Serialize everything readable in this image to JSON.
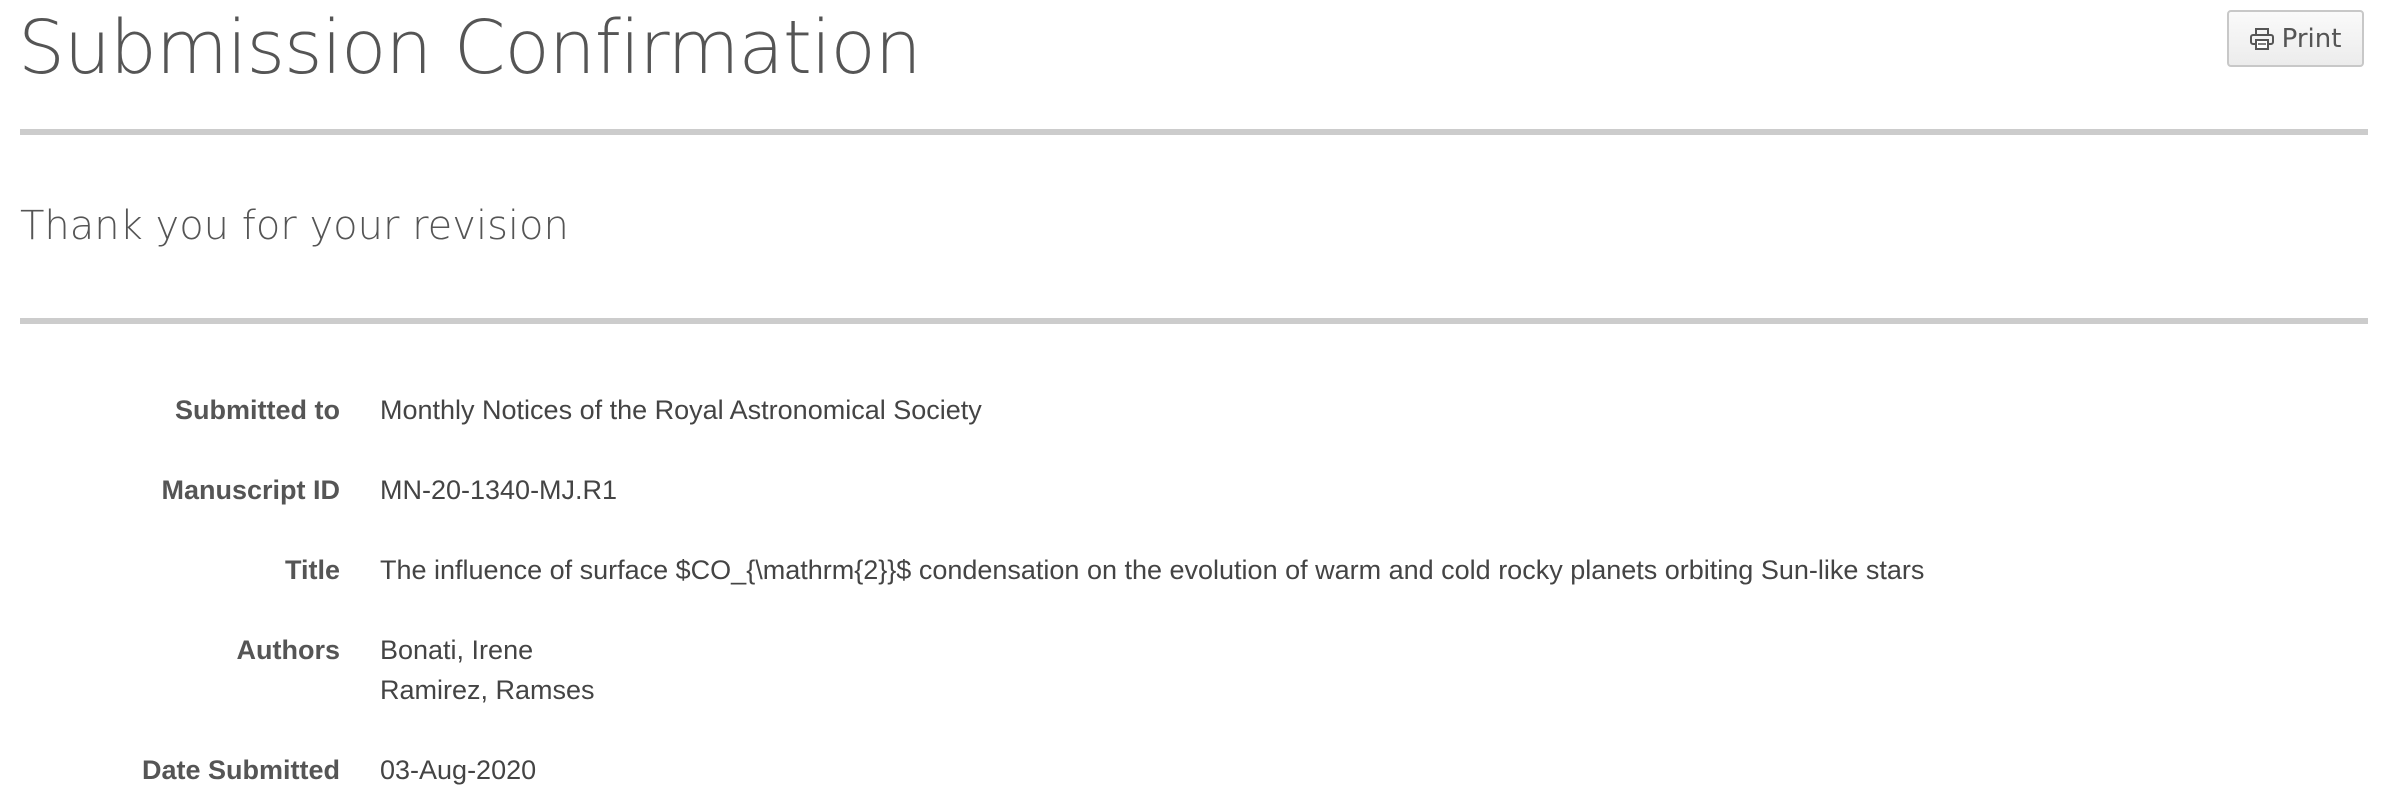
{
  "header": {
    "title": "Submission Confirmation",
    "print_label": "Print"
  },
  "message": {
    "subtitle": "Thank you for your revision"
  },
  "details": {
    "submitted_to": {
      "label": "Submitted to",
      "value": "Monthly Notices of the Royal Astronomical Society"
    },
    "manuscript_id": {
      "label": "Manuscript ID",
      "value": "MN-20-1340-MJ.R1"
    },
    "title": {
      "label": "Title",
      "value": "The influence of surface $CO_{\\mathrm{2}}$ condensation on the evolution of warm and cold rocky planets orbiting Sun-like stars"
    },
    "authors": {
      "label": "Authors",
      "names": [
        "Bonati, Irene",
        "Ramirez, Ramses"
      ]
    },
    "date_submitted": {
      "label": "Date Submitted",
      "value": "03-Aug-2020"
    }
  },
  "icons": {
    "print": "printer-icon"
  },
  "colors": {
    "text": "#555555",
    "rule": "#cccccc",
    "button_border": "#c8c8c8"
  }
}
